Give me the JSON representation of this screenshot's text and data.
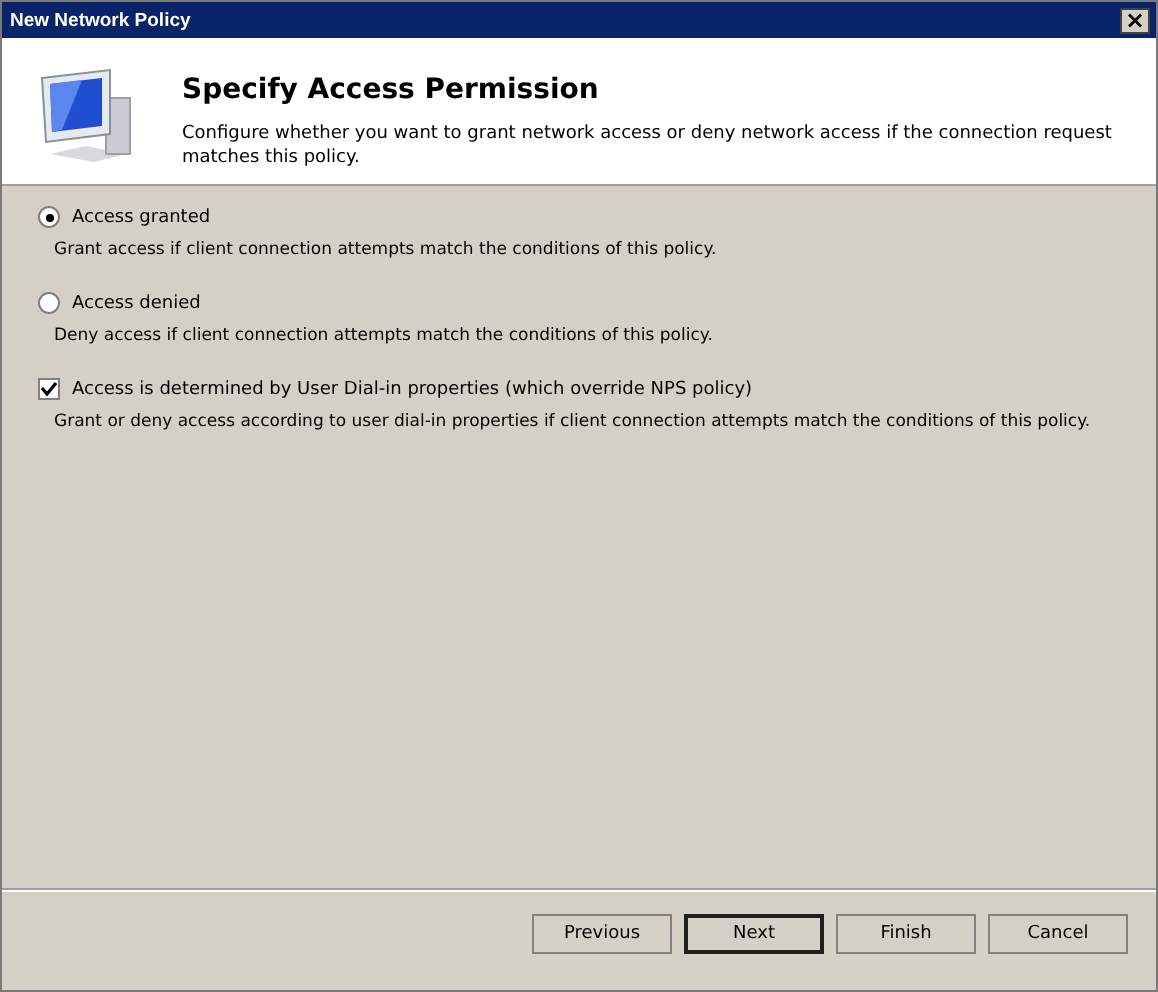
{
  "window": {
    "title": "New Network Policy",
    "close": "×"
  },
  "header": {
    "title": "Specify Access Permission",
    "description": "Configure whether you want to grant network access or deny network access if the connection request matches this policy."
  },
  "options": [
    {
      "kind": "radio",
      "label": "Access granted",
      "description": "Grant access if client connection attempts match the conditions of this policy.",
      "selected": true
    },
    {
      "kind": "radio",
      "label": "Access denied",
      "description": "Deny access if client connection attempts match the conditions of this policy.",
      "selected": false
    },
    {
      "kind": "checkbox",
      "label": "Access is determined by User Dial-in properties (which override NPS policy)",
      "description": "Grant or deny access according to user dial-in properties if client connection attempts match the conditions of this policy.",
      "checked": true
    }
  ],
  "buttons": [
    {
      "label": "Previous",
      "default": false
    },
    {
      "label": "Next",
      "default": true
    },
    {
      "label": "Finish",
      "default": false
    },
    {
      "label": "Cancel",
      "default": false
    }
  ]
}
